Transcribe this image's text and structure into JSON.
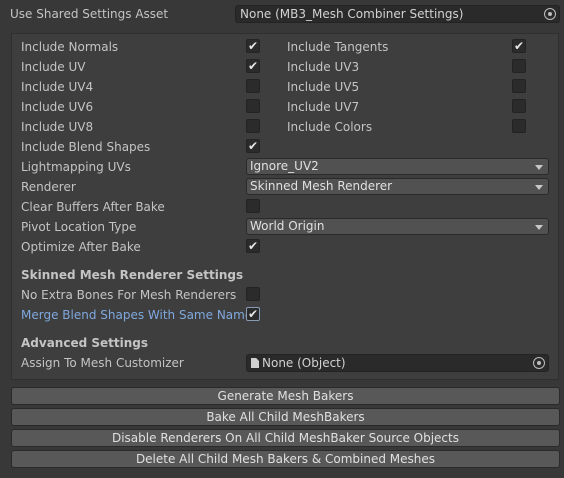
{
  "shared": {
    "label": "Use Shared Settings Asset",
    "value": "None (MB3_Mesh Combiner Settings)"
  },
  "toggles": {
    "include_normals": {
      "label": "Include Normals",
      "checked": true
    },
    "include_tangents": {
      "label": "Include Tangents",
      "checked": true
    },
    "include_uv": {
      "label": "Include UV",
      "checked": true
    },
    "include_uv3": {
      "label": "Include UV3",
      "checked": false
    },
    "include_uv4": {
      "label": "Include UV4",
      "checked": false
    },
    "include_uv5": {
      "label": "Include UV5",
      "checked": false
    },
    "include_uv6": {
      "label": "Include UV6",
      "checked": false
    },
    "include_uv7": {
      "label": "Include UV7",
      "checked": false
    },
    "include_uv8": {
      "label": "Include UV8",
      "checked": false
    },
    "include_colors": {
      "label": "Include Colors",
      "checked": false
    },
    "include_blend_shapes": {
      "label": "Include Blend Shapes",
      "checked": true
    },
    "clear_buffers": {
      "label": "Clear Buffers After Bake",
      "checked": false
    },
    "optimize_after_bake": {
      "label": "Optimize After Bake",
      "checked": true
    },
    "no_extra_bones": {
      "label": "No Extra Bones For Mesh Renderers",
      "checked": false
    },
    "merge_blend_shapes": {
      "label": "Merge Blend Shapes With Same Names",
      "checked": true
    }
  },
  "dropdowns": {
    "lightmapping_uvs": {
      "label": "Lightmapping UVs",
      "value": "Ignore_UV2"
    },
    "renderer": {
      "label": "Renderer",
      "value": "Skinned Mesh Renderer"
    },
    "pivot_location": {
      "label": "Pivot Location Type",
      "value": "World Origin"
    }
  },
  "sections": {
    "skinned": "Skinned Mesh Renderer Settings",
    "advanced": "Advanced Settings"
  },
  "assign": {
    "label": "Assign To Mesh Customizer",
    "value": "None (Object)"
  },
  "buttons": {
    "generate": "Generate Mesh Bakers",
    "bake_all": "Bake All Child MeshBakers",
    "disable": "Disable Renderers On All Child MeshBaker Source Objects",
    "delete": "Delete All Child Mesh Bakers & Combined Meshes"
  },
  "check_glyph": "✔",
  "colors": {
    "background": "#383838",
    "panel": "#3e3e3e",
    "highlight_text": "#7fa8de"
  },
  "icons": [
    "object-picker-icon",
    "document-icon",
    "dropdown-caret-icon",
    "checkmark-icon"
  ]
}
